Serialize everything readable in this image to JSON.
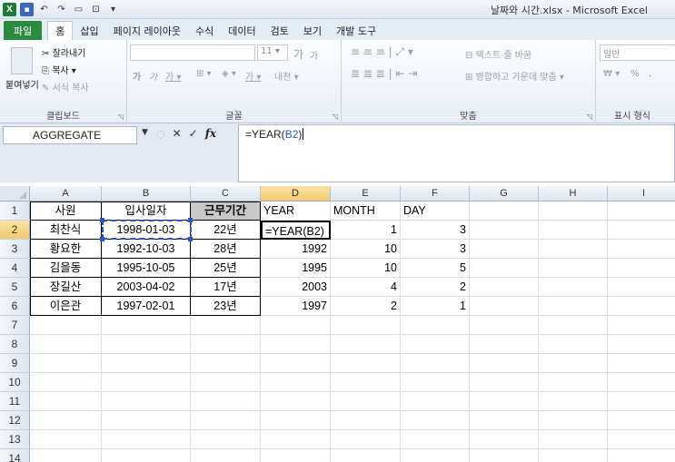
{
  "window": {
    "title": "날짜와 시간.xlsx  -  Microsoft Excel",
    "icons": [
      "excel-logo-icon",
      "save-icon",
      "undo-icon",
      "redo-icon",
      "new-icon",
      "open-icon",
      "customize-icon"
    ]
  },
  "ribbon_tabs": [
    "파일",
    "홈",
    "삽입",
    "페이지 레이아웃",
    "수식",
    "데이터",
    "검토",
    "보기",
    "개발 도구"
  ],
  "active_tab": "홈",
  "ribbon": {
    "clipboard": {
      "paste": "붙여넣기",
      "cut": "잘라내기",
      "copy": "복사 ▾",
      "format_painter": "서식 복사",
      "label": "클립보드"
    },
    "font": {
      "size": "11",
      "grow": "가",
      "shrink": "가",
      "bold": "가",
      "italic": "가",
      "underline": "가 ▾",
      "label": "글꼴"
    },
    "alignment": {
      "wrap_text": "텍스트 줄 바꿈",
      "merge_center": "병합하고 가운데 맞춤 ▾",
      "label": "맞춤"
    },
    "number": {
      "format": "일반",
      "percent": "%",
      "comma": ",",
      "label": "표시 형식"
    }
  },
  "formula_bar": {
    "name_box": "AGGREGATE",
    "fx": "fx",
    "formula_prefix": "=YEAR(",
    "formula_ref": "B2",
    "formula_suffix": ")"
  },
  "columns": [
    "A",
    "B",
    "C",
    "D",
    "E",
    "F",
    "G",
    "H",
    "I"
  ],
  "rows": [
    "1",
    "2",
    "3",
    "4",
    "5",
    "6",
    "7",
    "8",
    "9",
    "10",
    "11",
    "12",
    "13",
    "14"
  ],
  "sheet": {
    "header": [
      "사원",
      "입사일자",
      "근무기간",
      "YEAR",
      "MONTH",
      "DAY"
    ],
    "data": [
      [
        "최찬식",
        "1998-01-03",
        "22년",
        "=YEAR(B2)",
        "1",
        "3"
      ],
      [
        "황요한",
        "1992-10-03",
        "28년",
        "1992",
        "10",
        "3"
      ],
      [
        "김을동",
        "1995-10-05",
        "25년",
        "1995",
        "10",
        "5"
      ],
      [
        "장길산",
        "2003-04-02",
        "17년",
        "2003",
        "4",
        "2"
      ],
      [
        "이은관",
        "1997-02-01",
        "23년",
        "1997",
        "2",
        "1"
      ]
    ]
  }
}
